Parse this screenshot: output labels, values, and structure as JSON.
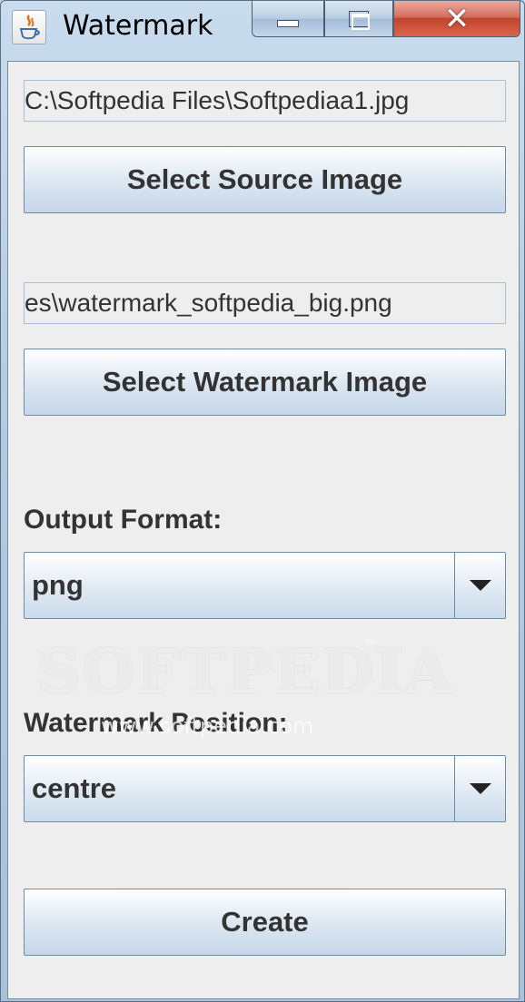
{
  "window": {
    "title": "Watermark",
    "close_glyph": "✕"
  },
  "source": {
    "path": "C:\\Softpedia Files\\Softpediaa1.jpg",
    "button_label": "Select Source Image"
  },
  "watermark": {
    "path": "es\\watermark_softpedia_big.png",
    "button_label": "Select Watermark Image"
  },
  "output_format": {
    "label": "Output Format:",
    "selected": "png"
  },
  "position": {
    "label": "Watermark Position:",
    "selected": "centre"
  },
  "create_button_label": "Create",
  "overlay": {
    "brand": "SOFTPEDIA",
    "trademark": "™",
    "url": "www.softpedia.com"
  },
  "icons": [
    "java-app-icon",
    "minimize-icon",
    "maximize-icon",
    "close-icon",
    "dropdown-arrow-icon"
  ]
}
